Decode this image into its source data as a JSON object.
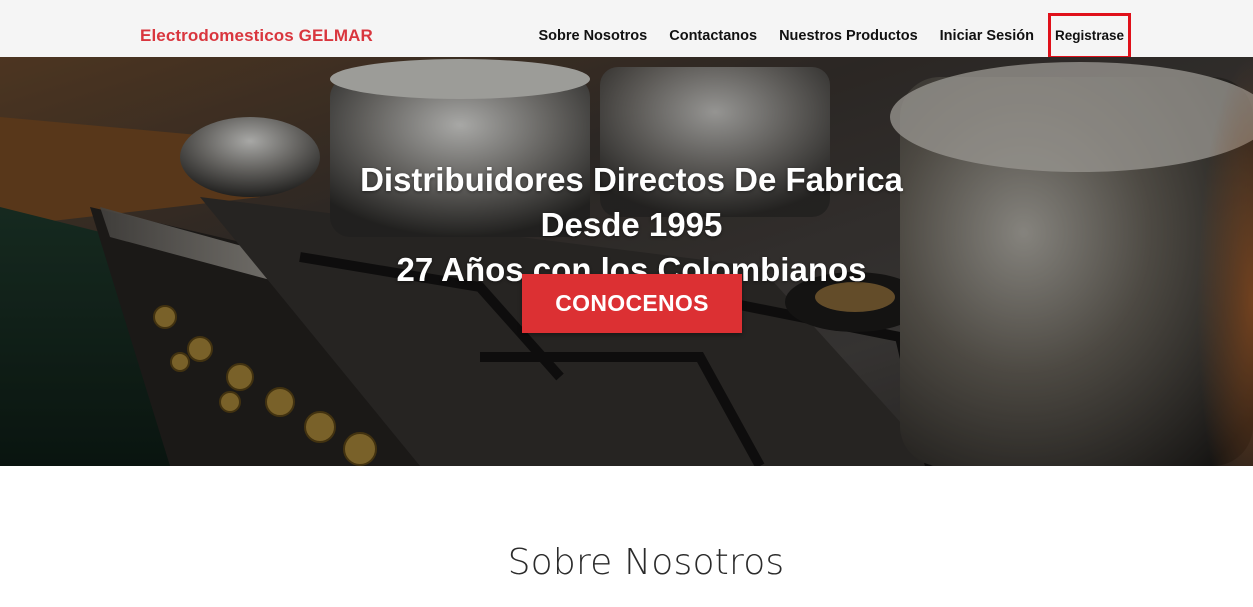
{
  "navbar": {
    "brand": "Electrodomesticos GELMAR",
    "links": [
      {
        "label": "Sobre Nosotros"
      },
      {
        "label": "Contactanos"
      },
      {
        "label": "Nuestros Productos"
      },
      {
        "label": "Iniciar Sesión"
      },
      {
        "label": "Registrase"
      }
    ]
  },
  "hero": {
    "title_lines": [
      "Distribuidores Directos De Fabrica",
      "Desde 1995",
      "27 Años con los Colombianos"
    ],
    "cta_label": "CONOCENOS",
    "background_image": "kitchen-stove-with-pots"
  },
  "about": {
    "heading": "Sobre Nosotros"
  },
  "colors": {
    "brand": "#d9363e",
    "cta": "#dc3033",
    "highlight_outline": "#e0101a",
    "navbar_bg": "#f5f5f5"
  }
}
